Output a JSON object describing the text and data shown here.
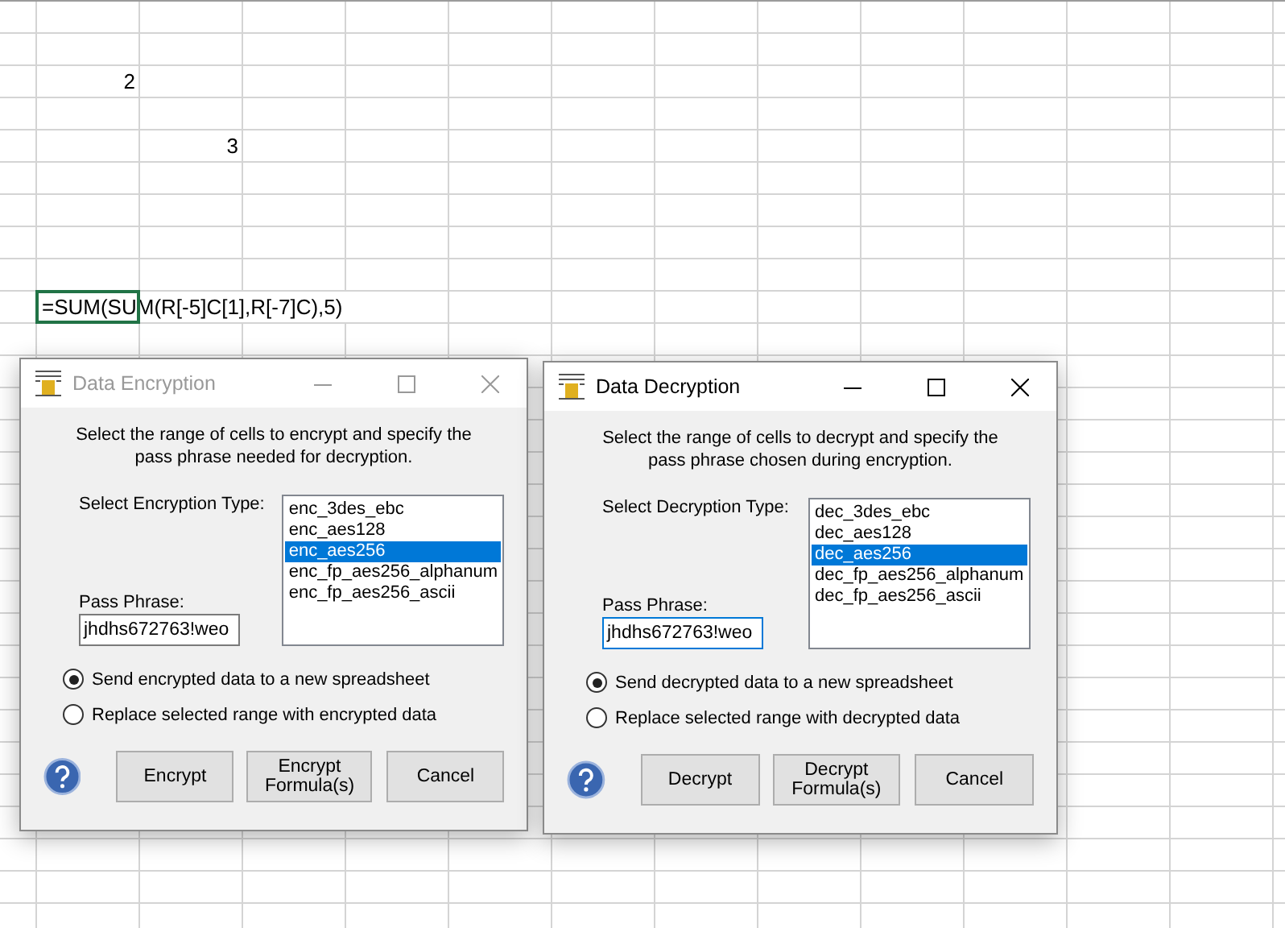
{
  "sheet": {
    "cells": [
      {
        "kind": "number",
        "text": "2",
        "selected": false
      },
      {
        "kind": "number",
        "text": "3",
        "selected": false
      },
      {
        "kind": "formula",
        "text": "=SUM(SUM(R[-5]C[1],R[-7]C),5)",
        "selected": true
      }
    ]
  },
  "dialogs": [
    {
      "title": "Data Encryption",
      "active": false,
      "description": "Select the range of cells to encrypt and specify the pass phrase needed for decryption.",
      "type_label": "Select Encryption Type:",
      "types": [
        {
          "label": "enc_3des_ebc",
          "selected": false
        },
        {
          "label": "enc_aes128",
          "selected": false
        },
        {
          "label": "enc_aes256",
          "selected": true
        },
        {
          "label": "enc_fp_aes256_alphanum",
          "selected": false
        },
        {
          "label": "enc_fp_aes256_ascii",
          "selected": false
        }
      ],
      "pass_label": "Pass Phrase:",
      "pass_value": "jhdhs672763!weo",
      "pass_focused": false,
      "options": [
        {
          "label": "Send encrypted data to a new spreadsheet",
          "selected": true
        },
        {
          "label": "Replace selected range with encrypted data",
          "selected": false
        }
      ],
      "buttons": [
        "Encrypt",
        "Encrypt Formula(s)",
        "Cancel"
      ]
    },
    {
      "title": "Data Decryption",
      "active": true,
      "description": "Select the range of cells to decrypt and specify the pass phrase chosen during encryption.",
      "type_label": "Select Decryption Type:",
      "types": [
        {
          "label": "dec_3des_ebc",
          "selected": false
        },
        {
          "label": "dec_aes128",
          "selected": false
        },
        {
          "label": "dec_aes256",
          "selected": true
        },
        {
          "label": "dec_fp_aes256_alphanum",
          "selected": false
        },
        {
          "label": "dec_fp_aes256_ascii",
          "selected": false
        }
      ],
      "pass_label": "Pass Phrase:",
      "pass_value": "jhdhs672763!weo",
      "pass_focused": true,
      "options": [
        {
          "label": "Send decrypted data to a new spreadsheet",
          "selected": true
        },
        {
          "label": "Replace selected range with decrypted data",
          "selected": false
        }
      ],
      "buttons": [
        "Decrypt",
        "Decrypt Formula(s)",
        "Cancel"
      ]
    }
  ]
}
